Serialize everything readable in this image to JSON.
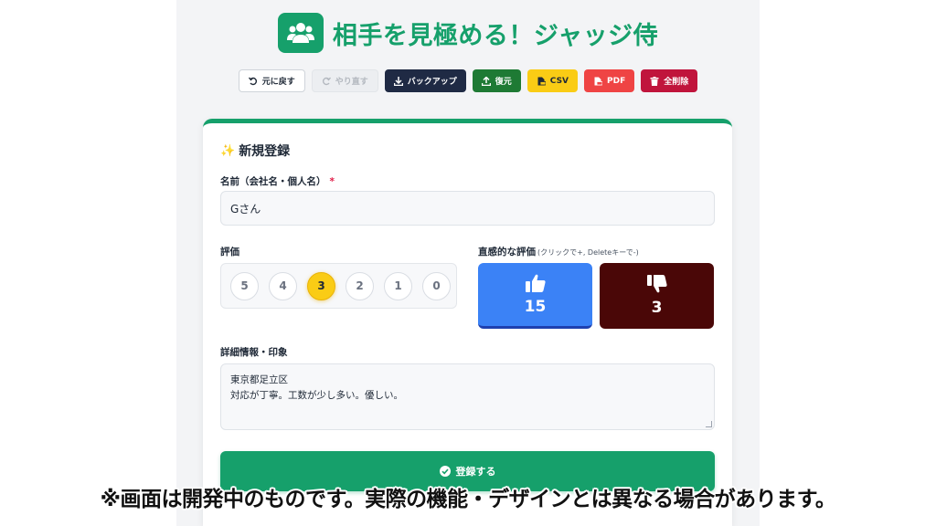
{
  "app": {
    "title": "相手を見極める！ジャッジ侍",
    "logo_icon": "users-icon",
    "accent": "#16a06b"
  },
  "toolbar": {
    "undo": "元に戻す",
    "redo": "やり直す",
    "backup": "バックアップ",
    "restore": "復元",
    "csv": "CSV",
    "pdf": "PDF",
    "delete_all": "全削除"
  },
  "form": {
    "title": "新規登録",
    "name_label": "名前（会社名・個人名）",
    "required_mark": "*",
    "name_value": "Gさん",
    "rating_label": "評価",
    "rating_options": [
      "5",
      "4",
      "3",
      "2",
      "1",
      "0"
    ],
    "rating_selected": "3",
    "intuitive_label": "直感的な評価",
    "intuitive_hint": "(クリックで+, Deleteキーで-)",
    "thumbs_up_count": "15",
    "thumbs_down_count": "3",
    "details_label": "詳細情報・印象",
    "details_line1": "東京都足立区",
    "details_line2": "対応が丁寧。工数が少し多い。優しい。",
    "submit_label": "登録する"
  },
  "disclaimer": "※画面は開発中のものです。実際の機能・デザインとは異なる場合があります。"
}
